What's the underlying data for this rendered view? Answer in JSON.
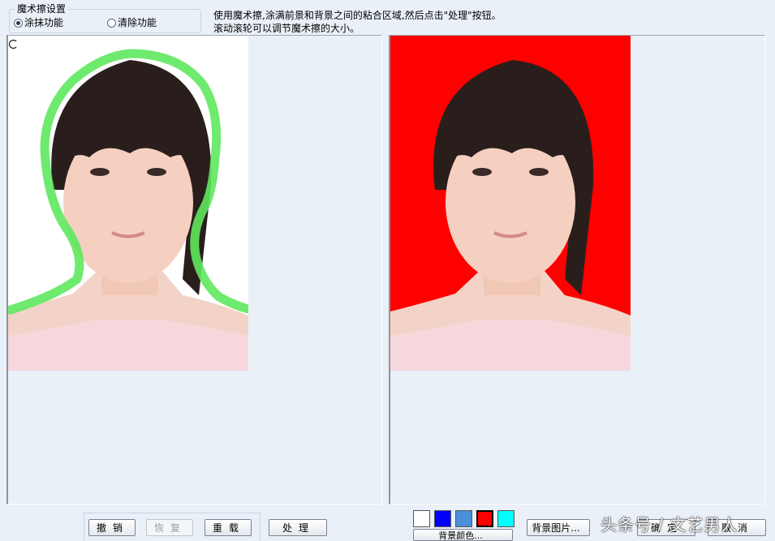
{
  "settings": {
    "title": "魔术擦设置",
    "options": [
      {
        "label": "涂抹功能",
        "selected": true
      },
      {
        "label": "清除功能",
        "selected": false
      }
    ]
  },
  "instructions": {
    "line1": "使用魔术擦,涂满前景和背景之间的粘合区域,然后点击\"处理\"按钮。",
    "line2": "滚动滚轮可以调节魔术擦的大小。"
  },
  "toolbar": {
    "undo": "撤销",
    "redo": "恢复",
    "reload": "重载",
    "process": "处理",
    "bg_color": "背景颜色...",
    "bg_image": "背景图片...",
    "ok": "确定",
    "cancel": "取消"
  },
  "swatches": [
    "#ffffff",
    "#0000ff",
    "#4a8fd8",
    "#ff0000",
    "#00ffff"
  ],
  "colors": {
    "photo_left_bg": "#ffffff",
    "photo_right_bg": "#ff0000",
    "brush_stroke": "#5ee85e"
  },
  "watermark": "头条号 / 文艺男人"
}
